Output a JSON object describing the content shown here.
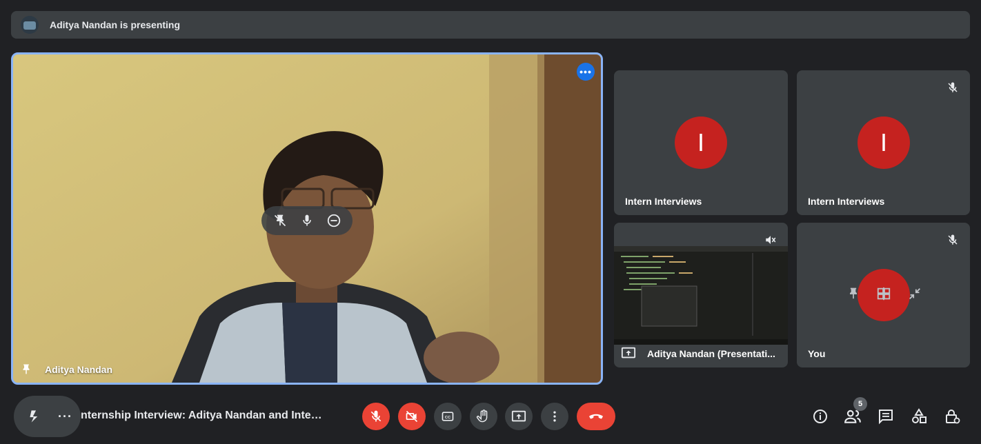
{
  "banner": {
    "text": "Aditya Nandan is presenting"
  },
  "main_tile": {
    "name": "Aditya Nandan"
  },
  "tiles": [
    {
      "name": "Intern Interviews",
      "initial": "I"
    },
    {
      "name": "Intern Interviews",
      "initial": "I"
    },
    {
      "name": "Aditya Nandan (Presentati..."
    },
    {
      "name": "You"
    }
  ],
  "meeting": {
    "title": "nternship Interview: Aditya Nandan and Inter..."
  },
  "people_count": "5",
  "colors": {
    "accent": "#8ab4f8",
    "red": "#ea4335",
    "avatar_red": "#c5221f",
    "surface": "#3c4043",
    "bg": "#202124"
  },
  "icons": [
    "pin-icon",
    "mic-off-icon",
    "mic-icon",
    "remove-icon",
    "more-icon",
    "volume-off-icon",
    "present-icon",
    "camera-off-icon",
    "captions-icon",
    "hand-icon",
    "end-call-icon",
    "info-icon",
    "people-icon",
    "chat-icon",
    "activities-icon",
    "host-controls-icon",
    "shrink-icon"
  ]
}
